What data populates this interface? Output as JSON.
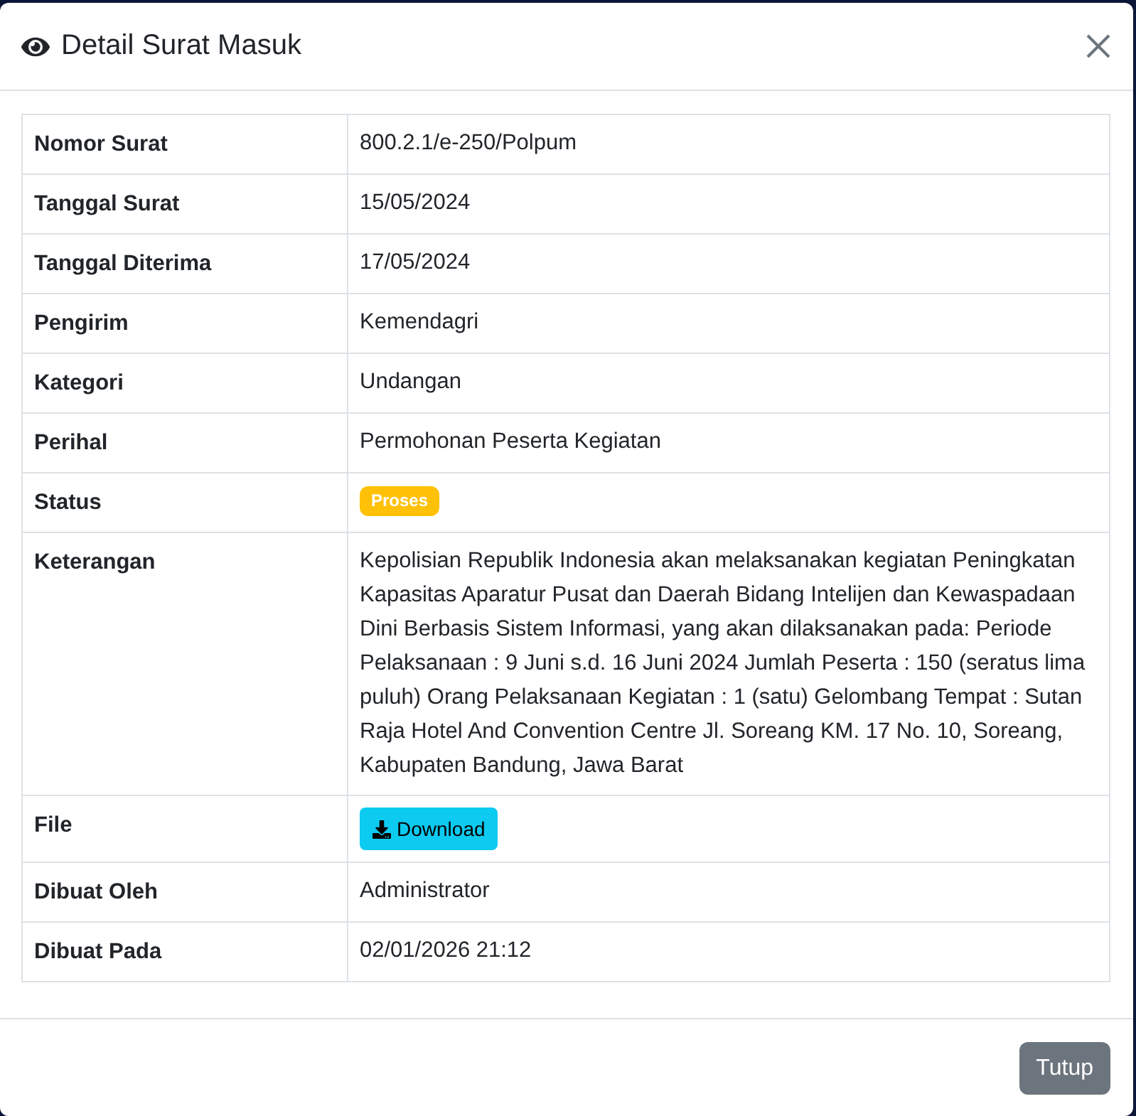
{
  "modal": {
    "title": "Detail Surat Masuk"
  },
  "details": [
    {
      "label": "Nomor Surat",
      "kind": "text",
      "value": "800.2.1/e-250/Polpum"
    },
    {
      "label": "Tanggal Surat",
      "kind": "text",
      "value": "15/05/2024"
    },
    {
      "label": "Tanggal Diterima",
      "kind": "text",
      "value": "17/05/2024"
    },
    {
      "label": "Pengirim",
      "kind": "text",
      "value": "Kemendagri"
    },
    {
      "label": "Kategori",
      "kind": "text",
      "value": "Undangan"
    },
    {
      "label": "Perihal",
      "kind": "text",
      "value": "Permohonan Peserta Kegiatan"
    },
    {
      "label": "Status",
      "kind": "badge",
      "value": "Proses"
    },
    {
      "label": "Keterangan",
      "kind": "text",
      "value": "Kepolisian Republik Indonesia akan melaksanakan kegiatan Peningkatan Kapasitas Aparatur Pusat dan Daerah Bidang Intelijen dan Kewaspadaan Dini Berbasis Sistem Informasi, yang akan dilaksanakan pada: Periode Pelaksanaan : 9 Juni s.d. 16 Juni 2024 Jumlah Peserta : 150 (seratus lima puluh) Orang Pelaksanaan Kegiatan : 1 (satu) Gelombang Tempat : Sutan Raja Hotel And Convention Centre Jl. Soreang KM. 17 No. 10, Soreang, Kabupaten Bandung, Jawa Barat"
    },
    {
      "label": "File",
      "kind": "button",
      "value": "Download"
    },
    {
      "label": "Dibuat Oleh",
      "kind": "text",
      "value": "Administrator"
    },
    {
      "label": "Dibuat Pada",
      "kind": "text",
      "value": "02/01/2026 21:12"
    }
  ],
  "footer": {
    "buttons": [
      "Tutup"
    ]
  }
}
